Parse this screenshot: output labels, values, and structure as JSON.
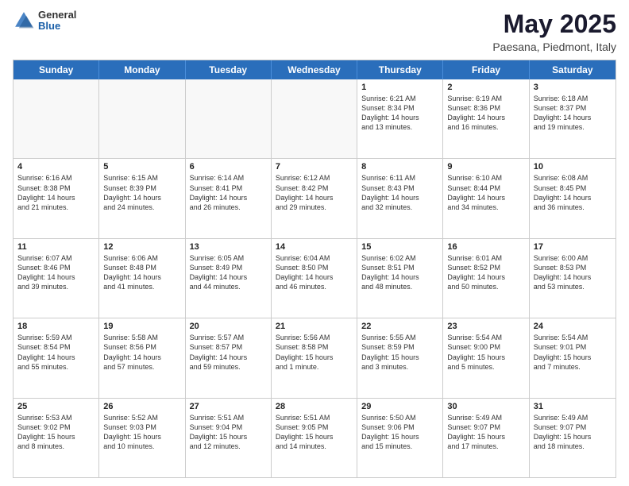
{
  "header": {
    "logo": {
      "general": "General",
      "blue": "Blue"
    },
    "title": "May 2025",
    "subtitle": "Paesana, Piedmont, Italy"
  },
  "weekdays": [
    "Sunday",
    "Monday",
    "Tuesday",
    "Wednesday",
    "Thursday",
    "Friday",
    "Saturday"
  ],
  "weeks": [
    [
      {
        "day": "",
        "info": ""
      },
      {
        "day": "",
        "info": ""
      },
      {
        "day": "",
        "info": ""
      },
      {
        "day": "",
        "info": ""
      },
      {
        "day": "1",
        "info": "Sunrise: 6:21 AM\nSunset: 8:34 PM\nDaylight: 14 hours\nand 13 minutes."
      },
      {
        "day": "2",
        "info": "Sunrise: 6:19 AM\nSunset: 8:36 PM\nDaylight: 14 hours\nand 16 minutes."
      },
      {
        "day": "3",
        "info": "Sunrise: 6:18 AM\nSunset: 8:37 PM\nDaylight: 14 hours\nand 19 minutes."
      }
    ],
    [
      {
        "day": "4",
        "info": "Sunrise: 6:16 AM\nSunset: 8:38 PM\nDaylight: 14 hours\nand 21 minutes."
      },
      {
        "day": "5",
        "info": "Sunrise: 6:15 AM\nSunset: 8:39 PM\nDaylight: 14 hours\nand 24 minutes."
      },
      {
        "day": "6",
        "info": "Sunrise: 6:14 AM\nSunset: 8:41 PM\nDaylight: 14 hours\nand 26 minutes."
      },
      {
        "day": "7",
        "info": "Sunrise: 6:12 AM\nSunset: 8:42 PM\nDaylight: 14 hours\nand 29 minutes."
      },
      {
        "day": "8",
        "info": "Sunrise: 6:11 AM\nSunset: 8:43 PM\nDaylight: 14 hours\nand 32 minutes."
      },
      {
        "day": "9",
        "info": "Sunrise: 6:10 AM\nSunset: 8:44 PM\nDaylight: 14 hours\nand 34 minutes."
      },
      {
        "day": "10",
        "info": "Sunrise: 6:08 AM\nSunset: 8:45 PM\nDaylight: 14 hours\nand 36 minutes."
      }
    ],
    [
      {
        "day": "11",
        "info": "Sunrise: 6:07 AM\nSunset: 8:46 PM\nDaylight: 14 hours\nand 39 minutes."
      },
      {
        "day": "12",
        "info": "Sunrise: 6:06 AM\nSunset: 8:48 PM\nDaylight: 14 hours\nand 41 minutes."
      },
      {
        "day": "13",
        "info": "Sunrise: 6:05 AM\nSunset: 8:49 PM\nDaylight: 14 hours\nand 44 minutes."
      },
      {
        "day": "14",
        "info": "Sunrise: 6:04 AM\nSunset: 8:50 PM\nDaylight: 14 hours\nand 46 minutes."
      },
      {
        "day": "15",
        "info": "Sunrise: 6:02 AM\nSunset: 8:51 PM\nDaylight: 14 hours\nand 48 minutes."
      },
      {
        "day": "16",
        "info": "Sunrise: 6:01 AM\nSunset: 8:52 PM\nDaylight: 14 hours\nand 50 minutes."
      },
      {
        "day": "17",
        "info": "Sunrise: 6:00 AM\nSunset: 8:53 PM\nDaylight: 14 hours\nand 53 minutes."
      }
    ],
    [
      {
        "day": "18",
        "info": "Sunrise: 5:59 AM\nSunset: 8:54 PM\nDaylight: 14 hours\nand 55 minutes."
      },
      {
        "day": "19",
        "info": "Sunrise: 5:58 AM\nSunset: 8:56 PM\nDaylight: 14 hours\nand 57 minutes."
      },
      {
        "day": "20",
        "info": "Sunrise: 5:57 AM\nSunset: 8:57 PM\nDaylight: 14 hours\nand 59 minutes."
      },
      {
        "day": "21",
        "info": "Sunrise: 5:56 AM\nSunset: 8:58 PM\nDaylight: 15 hours\nand 1 minute."
      },
      {
        "day": "22",
        "info": "Sunrise: 5:55 AM\nSunset: 8:59 PM\nDaylight: 15 hours\nand 3 minutes."
      },
      {
        "day": "23",
        "info": "Sunrise: 5:54 AM\nSunset: 9:00 PM\nDaylight: 15 hours\nand 5 minutes."
      },
      {
        "day": "24",
        "info": "Sunrise: 5:54 AM\nSunset: 9:01 PM\nDaylight: 15 hours\nand 7 minutes."
      }
    ],
    [
      {
        "day": "25",
        "info": "Sunrise: 5:53 AM\nSunset: 9:02 PM\nDaylight: 15 hours\nand 8 minutes."
      },
      {
        "day": "26",
        "info": "Sunrise: 5:52 AM\nSunset: 9:03 PM\nDaylight: 15 hours\nand 10 minutes."
      },
      {
        "day": "27",
        "info": "Sunrise: 5:51 AM\nSunset: 9:04 PM\nDaylight: 15 hours\nand 12 minutes."
      },
      {
        "day": "28",
        "info": "Sunrise: 5:51 AM\nSunset: 9:05 PM\nDaylight: 15 hours\nand 14 minutes."
      },
      {
        "day": "29",
        "info": "Sunrise: 5:50 AM\nSunset: 9:06 PM\nDaylight: 15 hours\nand 15 minutes."
      },
      {
        "day": "30",
        "info": "Sunrise: 5:49 AM\nSunset: 9:07 PM\nDaylight: 15 hours\nand 17 minutes."
      },
      {
        "day": "31",
        "info": "Sunrise: 5:49 AM\nSunset: 9:07 PM\nDaylight: 15 hours\nand 18 minutes."
      }
    ]
  ]
}
